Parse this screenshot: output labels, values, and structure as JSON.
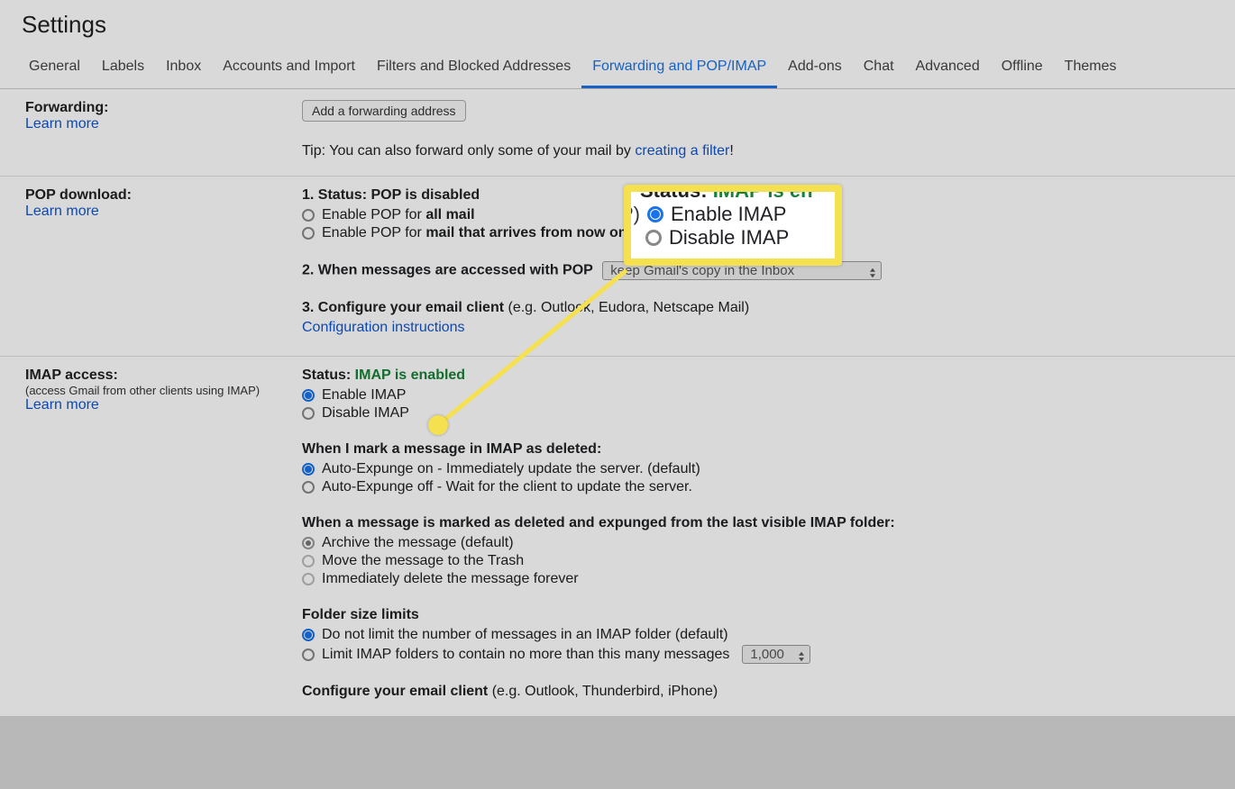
{
  "page_title": "Settings",
  "tabs": {
    "general": "General",
    "labels": "Labels",
    "inbox": "Inbox",
    "accounts": "Accounts and Import",
    "filters": "Filters and Blocked Addresses",
    "forwarding": "Forwarding and POP/IMAP",
    "addons": "Add-ons",
    "chat": "Chat",
    "advanced": "Advanced",
    "offline": "Offline",
    "themes": "Themes"
  },
  "forwarding": {
    "title": "Forwarding:",
    "learn_more": "Learn more",
    "add_button": "Add a forwarding address",
    "tip_prefix": "Tip: You can also forward only some of your mail by ",
    "tip_link": "creating a filter",
    "tip_suffix": "!"
  },
  "pop": {
    "title": "POP download:",
    "learn_more": "Learn more",
    "status_label": "1. Status: ",
    "status_value": "POP is disabled",
    "opt1_prefix": "Enable POP for ",
    "opt1_bold": "all mail",
    "opt2_prefix": "Enable POP for ",
    "opt2_bold": "mail that arrives from now on",
    "step2": "2. When messages are accessed with POP",
    "step2_select": "keep Gmail's copy in the Inbox",
    "step3_prefix": "3. Configure your email client ",
    "step3_suffix": "(e.g. Outlook, Eudora, Netscape Mail)",
    "config_link": "Configuration instructions"
  },
  "imap": {
    "title": "IMAP access:",
    "subdesc": "(access Gmail from other clients using IMAP)",
    "learn_more": "Learn more",
    "status_label": "Status: ",
    "status_value": "IMAP is enabled",
    "opt_enable": "Enable IMAP",
    "opt_disable": "Disable IMAP",
    "deleted_heading": "When I mark a message in IMAP as deleted:",
    "deleted_opt1": "Auto-Expunge on - Immediately update the server. (default)",
    "deleted_opt2": "Auto-Expunge off - Wait for the client to update the server.",
    "expunged_heading": "When a message is marked as deleted and expunged from the last visible IMAP folder:",
    "expunged_opt1": "Archive the message (default)",
    "expunged_opt2": "Move the message to the Trash",
    "expunged_opt3": "Immediately delete the message forever",
    "folder_heading": "Folder size limits",
    "folder_opt1": "Do not limit the number of messages in an IMAP folder (default)",
    "folder_opt2_prefix": "Limit IMAP folders to contain no more than this many messages",
    "folder_select": "1,000",
    "configure_prefix": "Configure your email client ",
    "configure_suffix": "(e.g. Outlook, Thunderbird, iPhone)"
  },
  "callout": {
    "status_prefix": "Status: ",
    "status_value": "IMAP is en",
    "p_prefix": "P)",
    "enable": "Enable IMAP",
    "disable": "Disable IMAP"
  }
}
